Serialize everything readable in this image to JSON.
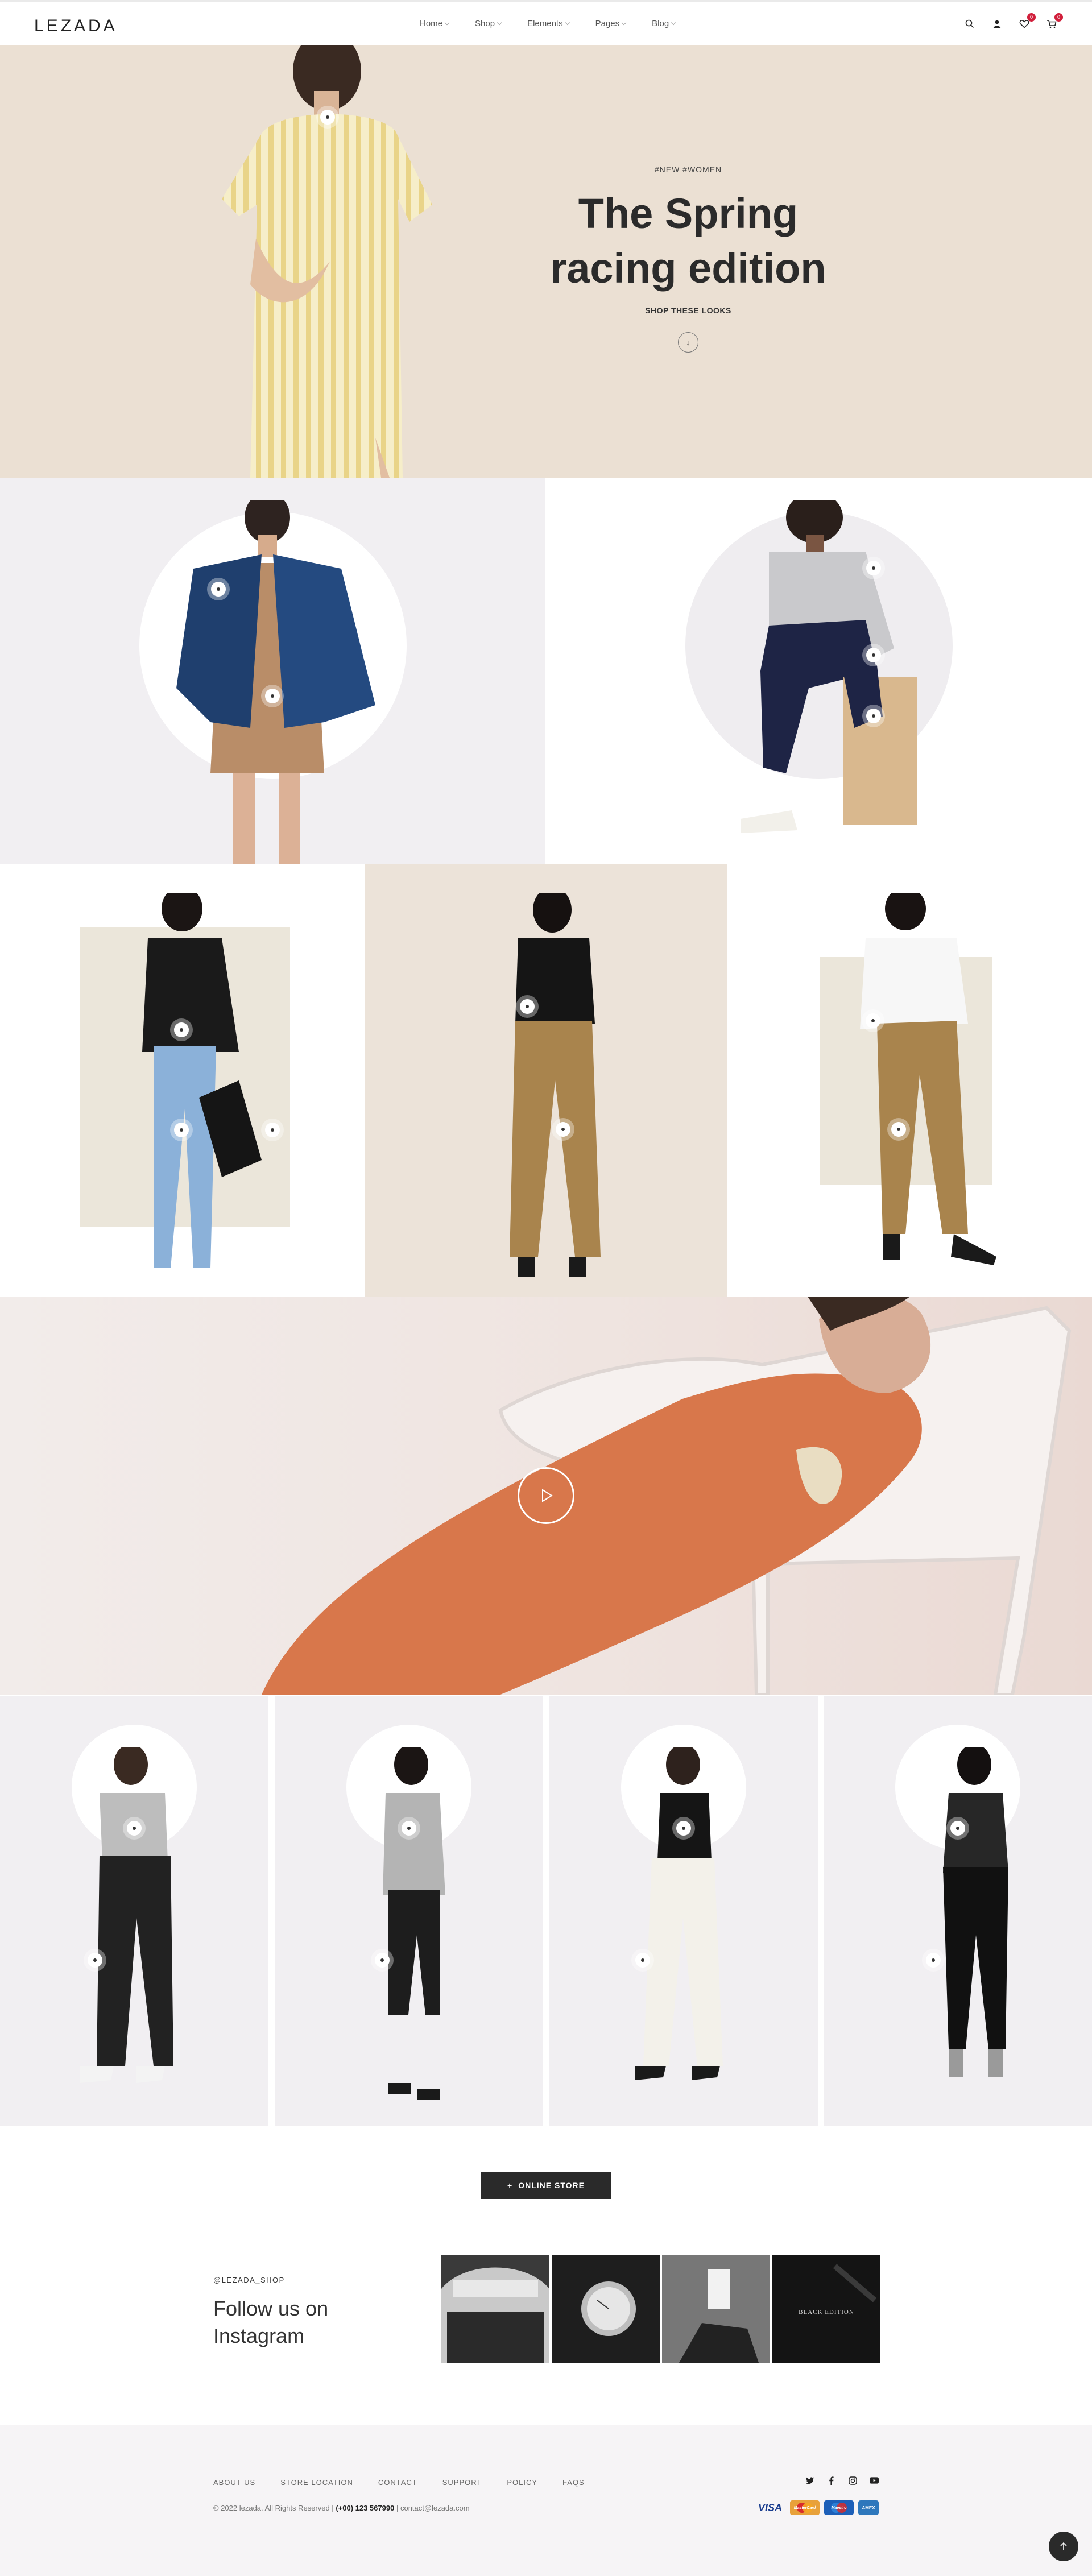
{
  "header": {
    "logo": "LEZADA",
    "nav": [
      "Home",
      "Shop",
      "Elements",
      "Pages",
      "Blog"
    ],
    "wishlist_count": "0",
    "cart_count": "0"
  },
  "hero": {
    "tag": "#NEW #WOMEN",
    "title_line1": "The Spring",
    "title_line2": "racing edition",
    "subtitle": "SHOP THESE LOOKS",
    "scroll_icon": "↓"
  },
  "cta": {
    "label": "ONLINE STORE",
    "icon": "+"
  },
  "instagram": {
    "handle": "@LEZADA_SHOP",
    "title": "Follow us on Instagram",
    "items": [
      "instagram-photo-1",
      "instagram-photo-2",
      "instagram-photo-3",
      "instagram-photo-4"
    ],
    "edition_label": "BLACK EDITION"
  },
  "footer": {
    "links": [
      "ABOUT US",
      "STORE LOCATION",
      "CONTACT",
      "SUPPORT",
      "POLICY",
      "FAQS"
    ],
    "copyright": "© 2022 lezada. All Rights Reserved |",
    "phone": "(+00) 123 567990",
    "email_sep": "|",
    "email": "contact@lezada.com",
    "social": [
      "twitter-icon",
      "facebook-icon",
      "instagram-icon",
      "youtube-icon"
    ],
    "payments": [
      "VISA",
      "MasterCard",
      "Maestro",
      "AMEX"
    ]
  },
  "colors": {
    "hero_bg": "#ebe0d3",
    "dark": "#2a2a2a",
    "badge": "#d11f3b",
    "tile_grey": "#f1eff2",
    "tile_beige": "#ece3d9"
  }
}
